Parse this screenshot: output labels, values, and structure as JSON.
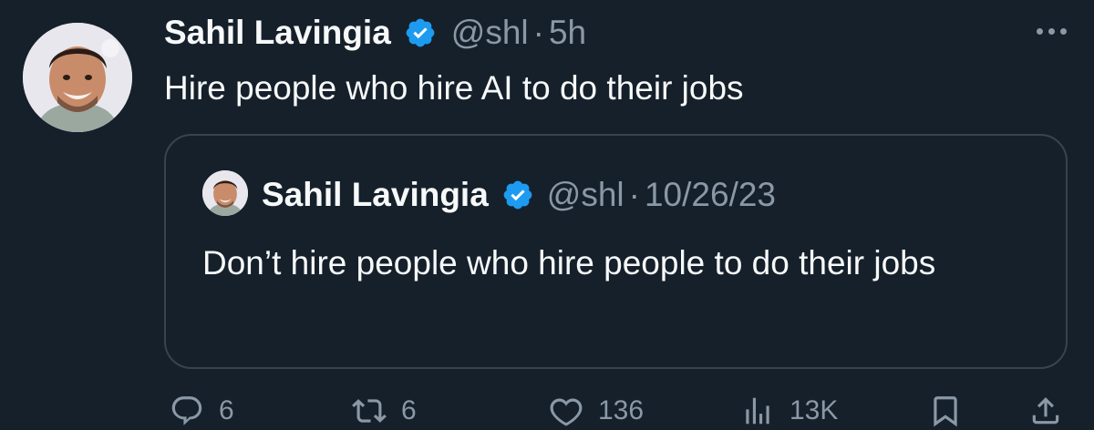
{
  "tweet": {
    "author": {
      "name": "Sahil Lavingia",
      "handle": "@shl",
      "avatar_icon": "avatar-photo"
    },
    "separator": "·",
    "time": "5h",
    "text": "Hire people who hire AI to do their jobs",
    "verified_icon": "verified-badge-icon",
    "more_icon": "more-options-icon"
  },
  "quoted": {
    "author": {
      "name": "Sahil Lavingia",
      "handle": "@shl",
      "avatar_icon": "avatar-photo"
    },
    "separator": "·",
    "time": "10/26/23",
    "text": "Don’t hire people who hire people to do their jobs"
  },
  "actions": {
    "reply": {
      "icon": "reply-icon",
      "count": "6"
    },
    "repost": {
      "icon": "repost-icon",
      "count": "6"
    },
    "like": {
      "icon": "like-icon",
      "count": "136"
    },
    "views": {
      "icon": "views-icon",
      "count": "13K"
    },
    "bookmark": {
      "icon": "bookmark-icon"
    },
    "share": {
      "icon": "share-icon"
    }
  },
  "colors": {
    "background": "#15202b",
    "text": "#f7f9f9",
    "muted": "#8b98a5",
    "border": "#38444d",
    "verified": "#1d9bf0"
  }
}
